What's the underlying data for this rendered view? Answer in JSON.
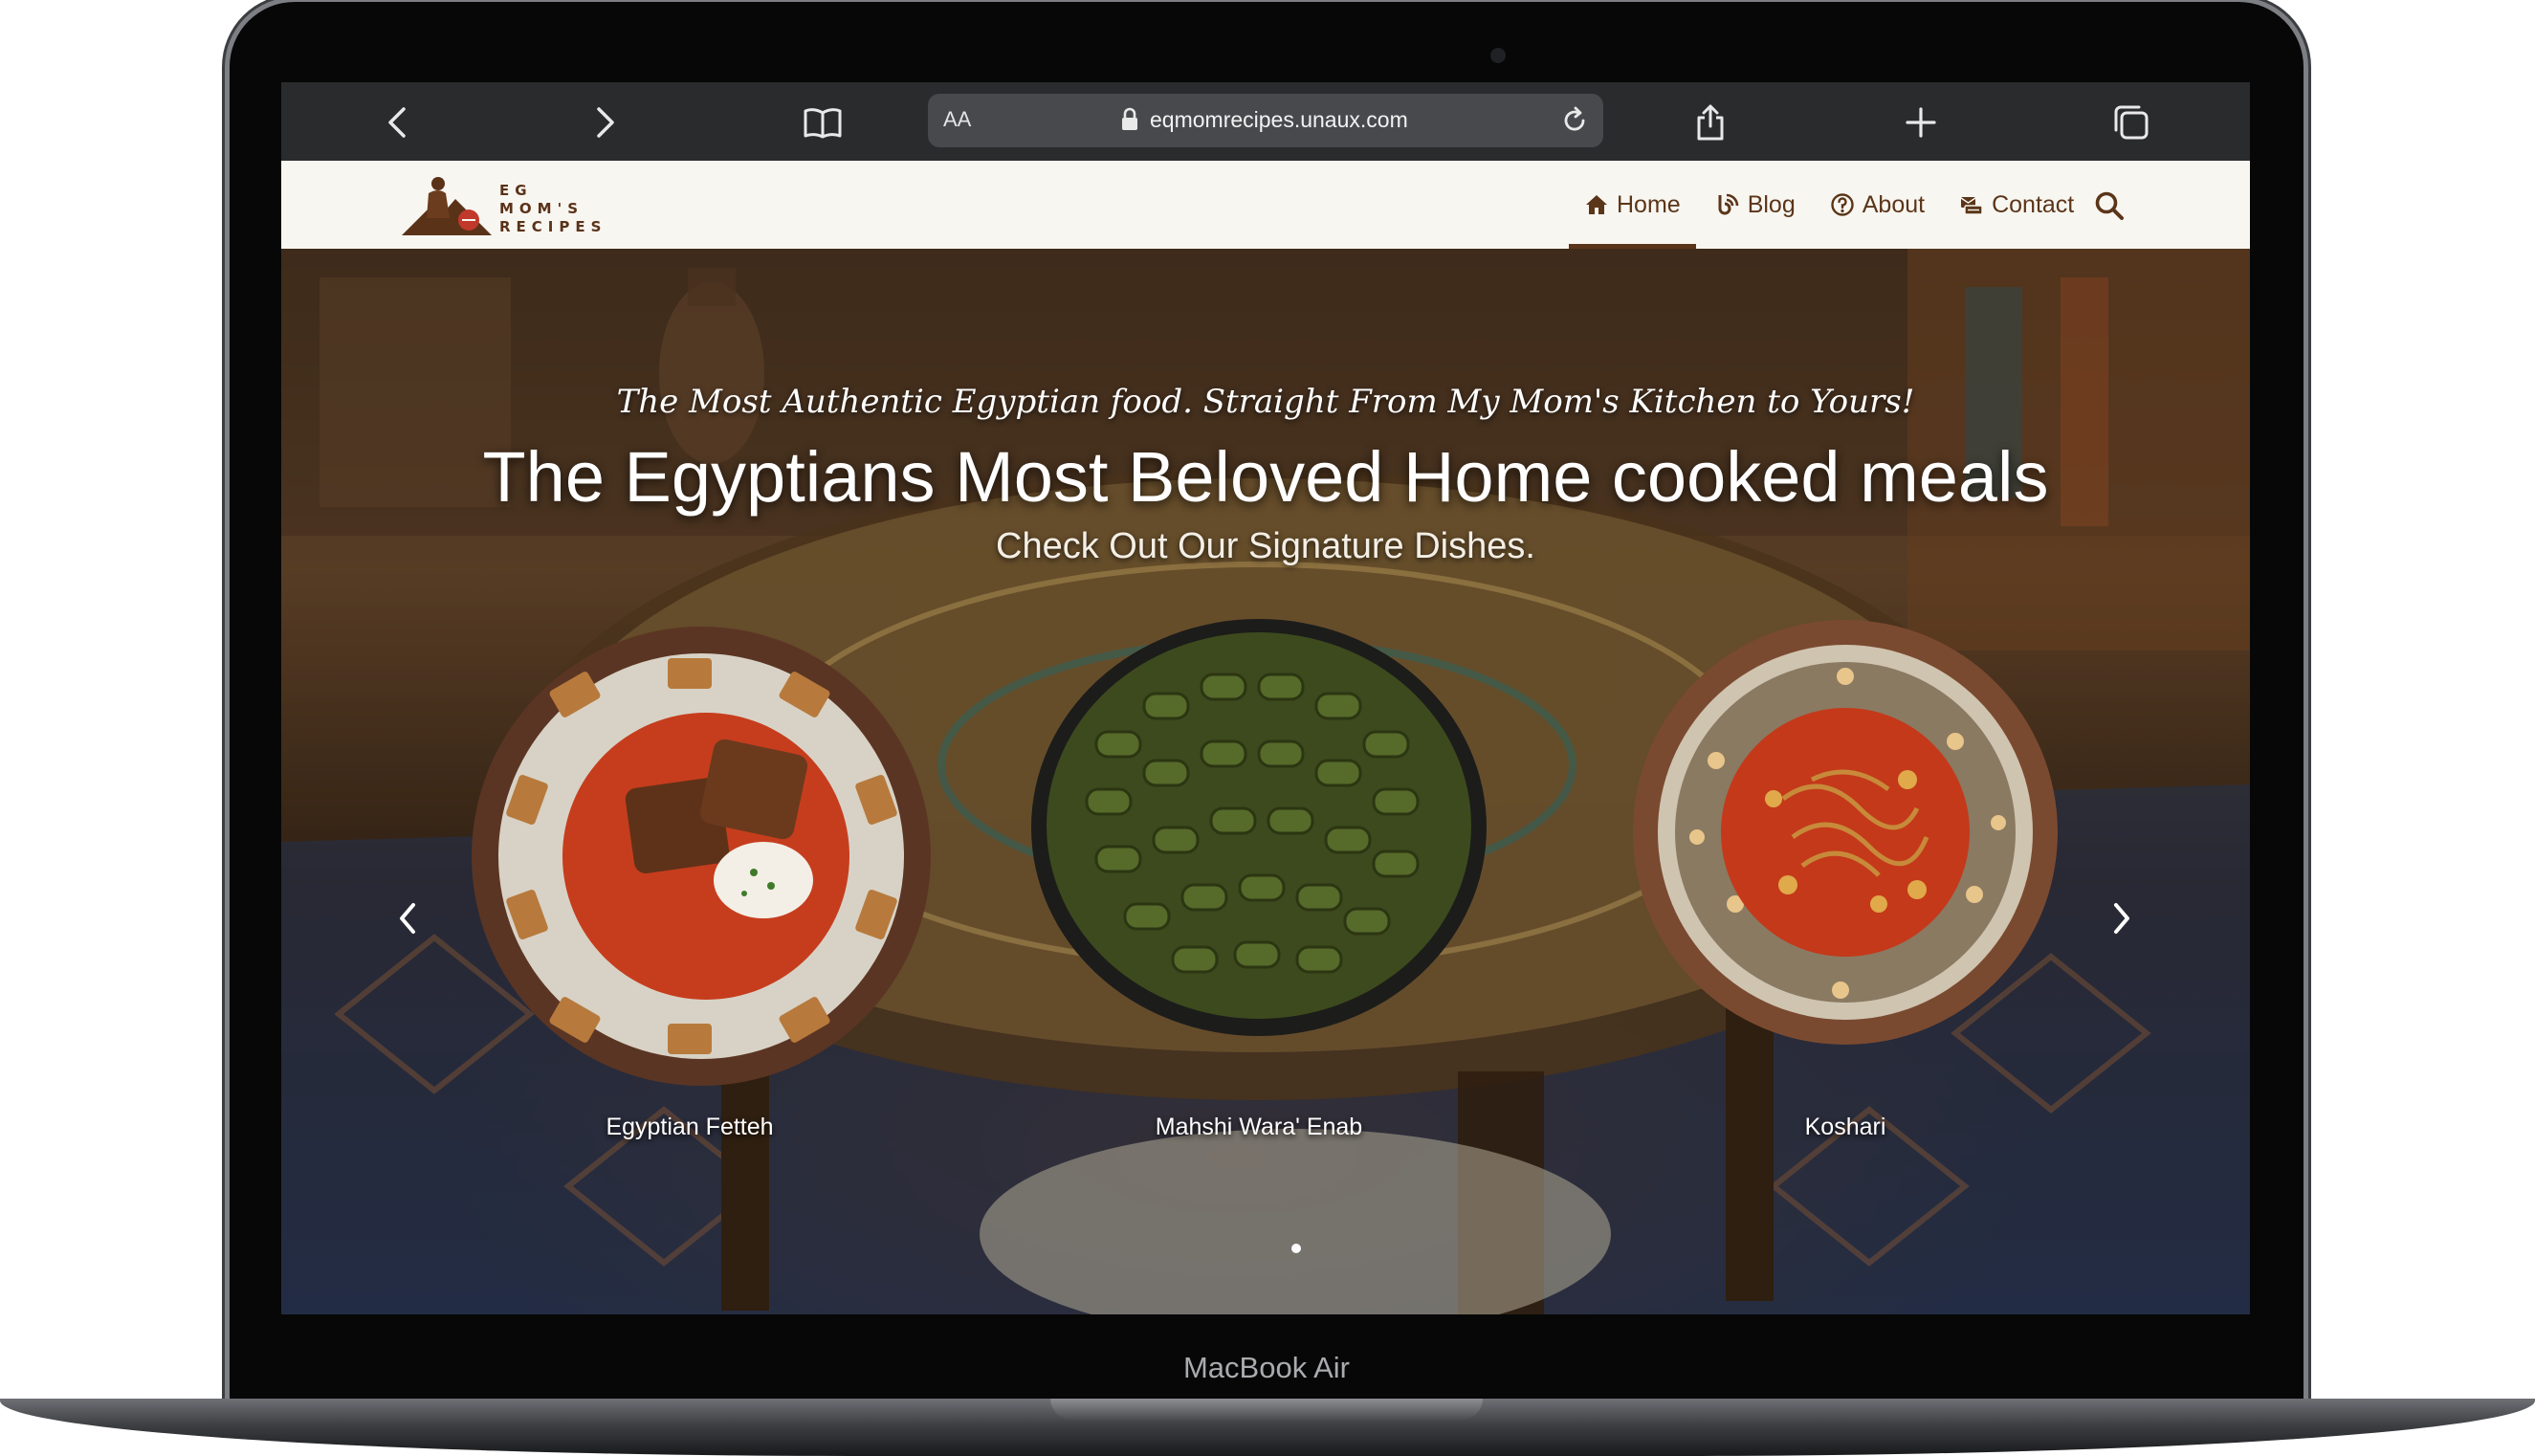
{
  "device": {
    "bezel_label": "MacBook Air"
  },
  "browser": {
    "text_size_label": "AA",
    "url": "eqmomrecipes.unaux.com",
    "icons": [
      "back-icon",
      "forward-icon",
      "bookmarks-icon",
      "lock-icon",
      "reload-icon",
      "share-icon",
      "new-tab-icon",
      "tabs-icon"
    ]
  },
  "site": {
    "logo_lines": [
      "EG",
      "MOM'S",
      "RECIPES"
    ],
    "nav": [
      {
        "label": "Home",
        "icon": "home-icon",
        "active": true
      },
      {
        "label": "Blog",
        "icon": "blog-icon",
        "active": false
      },
      {
        "label": "About",
        "icon": "question-circle-icon",
        "active": false
      },
      {
        "label": "Contact",
        "icon": "contact-icon",
        "active": false
      }
    ],
    "search_icon": "search-icon",
    "brand_color": "#5b3519"
  },
  "hero": {
    "tagline": "The Most Authentic Egyptian food. Straight From My Mom's Kitchen to Yours!",
    "title": "The Egyptians Most Beloved Home cooked meals",
    "subtitle": "Check Out Our Signature Dishes.",
    "dishes": [
      {
        "name": "Egyptian Fetteh"
      },
      {
        "name": "Mahshi Wara' Enab"
      },
      {
        "name": "Koshari"
      }
    ],
    "carousel_active_index": 1
  }
}
